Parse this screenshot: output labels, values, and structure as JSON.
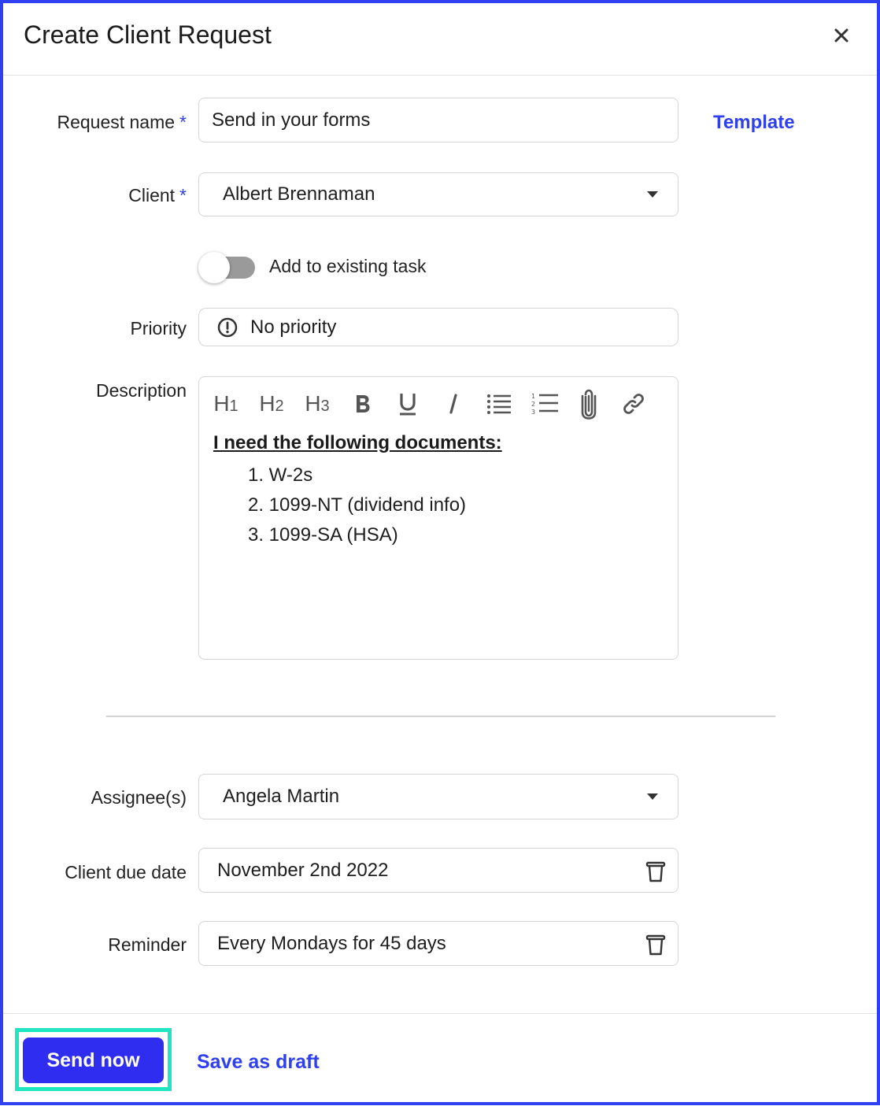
{
  "dialog": {
    "title": "Create Client Request",
    "close_icon": "close-icon"
  },
  "form": {
    "request_name": {
      "label": "Request name",
      "required_mark": "*",
      "value": "Send in your forms"
    },
    "template_link": "Template",
    "client": {
      "label": "Client",
      "required_mark": "*",
      "value": "Albert Brennaman"
    },
    "add_to_task": {
      "label": "Add to existing task",
      "enabled": false
    },
    "priority": {
      "label": "Priority",
      "value": "No priority",
      "icon": "alert-circle-icon"
    },
    "description": {
      "label": "Description",
      "toolbar": {
        "h1": {
          "letter": "H",
          "num": "1"
        },
        "h2": {
          "letter": "H",
          "num": "2"
        },
        "h3": {
          "letter": "H",
          "num": "3"
        },
        "bold": "bold-icon",
        "underline": "underline-icon",
        "italic": "italic-icon",
        "bullet_list": "bullet-list-icon",
        "numbered_list": "numbered-list-icon",
        "attach": "paperclip-icon",
        "link": "link-icon"
      },
      "heading": "I need the following documents:",
      "items": [
        "1. W-2s",
        "2. 1099-NT (dividend info)",
        "3. 1099-SA (HSA)"
      ]
    },
    "assignees": {
      "label": "Assignee(s)",
      "value": "Angela Martin"
    },
    "due_date": {
      "label": "Client due date",
      "value": "November 2nd 2022"
    },
    "reminder": {
      "label": "Reminder",
      "value": "Every Mondays for 45 days"
    }
  },
  "footer": {
    "send_label": "Send now",
    "draft_label": "Save as draft"
  },
  "colors": {
    "accent": "#2f40f0",
    "primary_button": "#2f2ef0",
    "highlight": "#1fe5c3",
    "border": "#d6d6d6"
  }
}
